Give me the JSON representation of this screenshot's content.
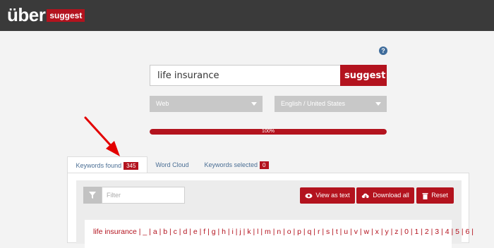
{
  "brand": {
    "name_main": "über",
    "name_tag": "suggest"
  },
  "help": {
    "label": "?"
  },
  "search": {
    "value": "life insurance",
    "button_label": "suggest"
  },
  "selects": {
    "source": "Web",
    "language": "English / United States"
  },
  "progress": {
    "label": "100%",
    "value": 1.0
  },
  "tabs": [
    {
      "label": "Keywords found",
      "badge": "345"
    },
    {
      "label": "Word Cloud"
    },
    {
      "label": "Keywords selected",
      "badge": "0"
    }
  ],
  "filter": {
    "placeholder": "Filter"
  },
  "actions": {
    "view_as_text": "View as text",
    "download_all": "Download all",
    "reset": "Reset"
  },
  "alphabet": "life insurance | _ | a | b | c | d | e | f | g | h | i | j | k | l | m | n | o | p | q | r | s | t | u | v | w | x | y | z | 0 | 1 | 2 | 3 | 4 | 5 | 6 |",
  "colors": {
    "accent": "#b3131e",
    "topbar": "#3a3a3a",
    "link": "#4a6e94"
  }
}
